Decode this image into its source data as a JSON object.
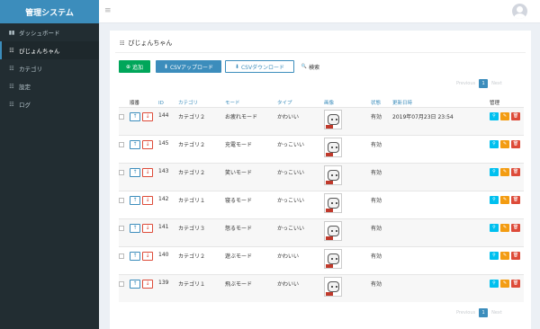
{
  "sidebar": {
    "logo": "管理システム",
    "items": [
      {
        "label": "ダッシュボード",
        "icon": "▮▮"
      },
      {
        "label": "ぴじょんちゃん",
        "icon": "☷"
      },
      {
        "label": "カテゴリ",
        "icon": "☷"
      },
      {
        "label": "設定",
        "icon": "☷"
      },
      {
        "label": "ログ",
        "icon": "☷"
      }
    ]
  },
  "topbar": {
    "menu_icon": "≡"
  },
  "page": {
    "title": "ぴじょんちゃん",
    "title_icon": "☷"
  },
  "toolbar": {
    "add_label": "追加",
    "add_icon": "⊕",
    "csv_upload_label": "CSVアップロード",
    "csv_upload_icon": "⬇",
    "csv_download_label": "CSVダウンロード",
    "csv_download_icon": "⬇",
    "search_label": "検索",
    "search_icon": "🔍"
  },
  "pager": {
    "prev": "Previous",
    "current": "1",
    "next": "Next"
  },
  "table": {
    "headers": {
      "order": "順番",
      "id": "ID",
      "category": "カテゴリ",
      "mode": "モード",
      "type": "タイプ",
      "image": "画像",
      "status": "状態",
      "updated": "更新日時",
      "manage": "管理"
    },
    "rows": [
      {
        "id": "144",
        "category": "カテゴリ２",
        "mode": "お疲れモード",
        "type": "かわいい",
        "status": "有効",
        "updated": "2019年07月23日 23:54"
      },
      {
        "id": "145",
        "category": "カテゴリ２",
        "mode": "充電モード",
        "type": "かっこいい",
        "status": "有効",
        "updated": ""
      },
      {
        "id": "143",
        "category": "カテゴリ２",
        "mode": "笑いモード",
        "type": "かっこいい",
        "status": "有効",
        "updated": ""
      },
      {
        "id": "142",
        "category": "カテゴリ１",
        "mode": "寝るモード",
        "type": "かっこいい",
        "status": "有効",
        "updated": ""
      },
      {
        "id": "141",
        "category": "カテゴリ３",
        "mode": "怒るモード",
        "type": "かっこいい",
        "status": "有効",
        "updated": ""
      },
      {
        "id": "140",
        "category": "カテゴリ２",
        "mode": "遊ぶモード",
        "type": "かわいい",
        "status": "有効",
        "updated": ""
      },
      {
        "id": "139",
        "category": "カテゴリ１",
        "mode": "飛ぶモード",
        "type": "かわいい",
        "status": "有効",
        "updated": ""
      }
    ]
  },
  "icons": {
    "up": "↑",
    "down": "↓",
    "view": "⚲",
    "edit": "✎",
    "delete": "🗑"
  },
  "colors": {
    "primary": "#3c8dbc",
    "success": "#00a65a",
    "danger": "#dd4b39",
    "warning": "#f39c12",
    "info": "#00c0ef",
    "sidebar": "#222d32"
  }
}
